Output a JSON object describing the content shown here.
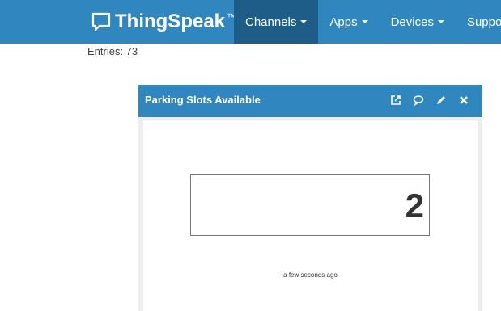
{
  "navbar": {
    "brand": "ThingSpeak",
    "brand_tm": "™",
    "items": [
      {
        "label": "Channels",
        "active": true
      },
      {
        "label": "Apps",
        "active": false
      },
      {
        "label": "Devices",
        "active": false
      },
      {
        "label": "Support",
        "active": false
      }
    ]
  },
  "entries": "Entries: 73",
  "widget": {
    "title": "Parking Slots Available",
    "value": "2",
    "timestamp": "a few seconds ago",
    "icons": [
      "external-link-icon",
      "comment-icon",
      "pencil-icon",
      "close-icon"
    ]
  },
  "colors": {
    "brand_blue": "#3087c0",
    "active_nav": "#1d5d87"
  }
}
